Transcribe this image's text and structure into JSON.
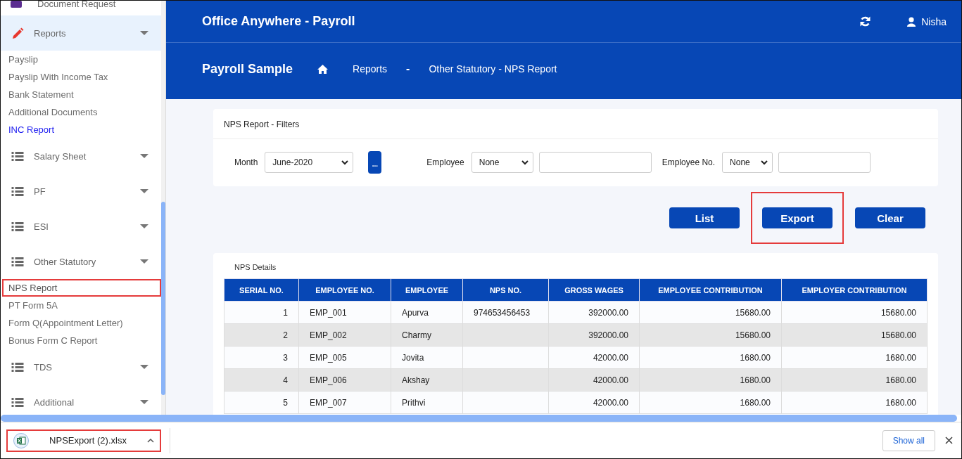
{
  "sidebar": {
    "top_item": {
      "label": "Document Request"
    },
    "groups": [
      {
        "label": "Reports",
        "selected": true,
        "children": [
          {
            "label": "Payslip",
            "visited": false,
            "highlighted": false
          },
          {
            "label": "Payslip With Income Tax",
            "visited": false,
            "highlighted": false
          },
          {
            "label": "Bank Statement",
            "visited": false,
            "highlighted": false
          },
          {
            "label": "Additional Documents",
            "visited": false,
            "highlighted": false
          },
          {
            "label": "INC Report",
            "visited": true,
            "highlighted": false
          }
        ]
      },
      {
        "label": "Salary Sheet",
        "selected": false
      },
      {
        "label": "PF",
        "selected": false
      },
      {
        "label": "ESI",
        "selected": false
      },
      {
        "label": "Other Statutory",
        "selected": false,
        "children": [
          {
            "label": "NPS Report",
            "visited": false,
            "highlighted": true
          },
          {
            "label": "PT Form 5A",
            "visited": false,
            "highlighted": false
          },
          {
            "label": "Form Q(Appointment Letter)",
            "visited": false,
            "highlighted": false
          },
          {
            "label": "Bonus Form C Report",
            "visited": false,
            "highlighted": false
          }
        ]
      },
      {
        "label": "TDS",
        "selected": false
      },
      {
        "label": "Additional",
        "selected": false
      }
    ]
  },
  "header": {
    "app_title": "Office Anywhere - Payroll",
    "user": "Nisha"
  },
  "breadcrumb": {
    "page_title": "Payroll Sample",
    "crumbs": [
      "Reports",
      "Other Statutory - NPS Report"
    ],
    "separator": "-"
  },
  "filters": {
    "title": "NPS Report - Filters",
    "fields": [
      {
        "kind": "select-button",
        "label": "Month",
        "value": "June-2020",
        "button": "..."
      },
      {
        "kind": "select-input",
        "label": "Employee",
        "value": "None"
      },
      {
        "kind": "select-input",
        "label": "Employee No.",
        "value": "None"
      }
    ]
  },
  "actions": [
    {
      "label": "List",
      "highlighted": false
    },
    {
      "label": "Export",
      "highlighted": true
    },
    {
      "label": "Clear",
      "highlighted": false
    }
  ],
  "table": {
    "title": "NPS Details",
    "columns": [
      "SERIAL NO.",
      "EMPLOYEE NO.",
      "EMPLOYEE",
      "NPS NO.",
      "GROSS WAGES",
      "EMPLOYEE CONTRIBUTION",
      "EMPLOYER CONTRIBUTION"
    ],
    "rows": [
      [
        "1",
        "EMP_001",
        "Apurva",
        "974653456453",
        "392000.00",
        "15680.00",
        "15680.00"
      ],
      [
        "2",
        "EMP_002",
        "Charmy",
        null,
        "392000.00",
        "15680.00",
        "15680.00"
      ],
      [
        "3",
        "EMP_005",
        "Jovita",
        null,
        "42000.00",
        "1680.00",
        "1680.00"
      ],
      [
        "4",
        "EMP_006",
        "Akshay",
        null,
        "42000.00",
        "1680.00",
        "1680.00"
      ],
      [
        "5",
        "EMP_007",
        "Prithvi",
        null,
        "42000.00",
        "1680.00",
        "1680.00"
      ]
    ]
  },
  "download_bar": {
    "file": {
      "name": "NPSExport (2).xlsx",
      "highlighted": true
    },
    "show_all": "Show all"
  }
}
